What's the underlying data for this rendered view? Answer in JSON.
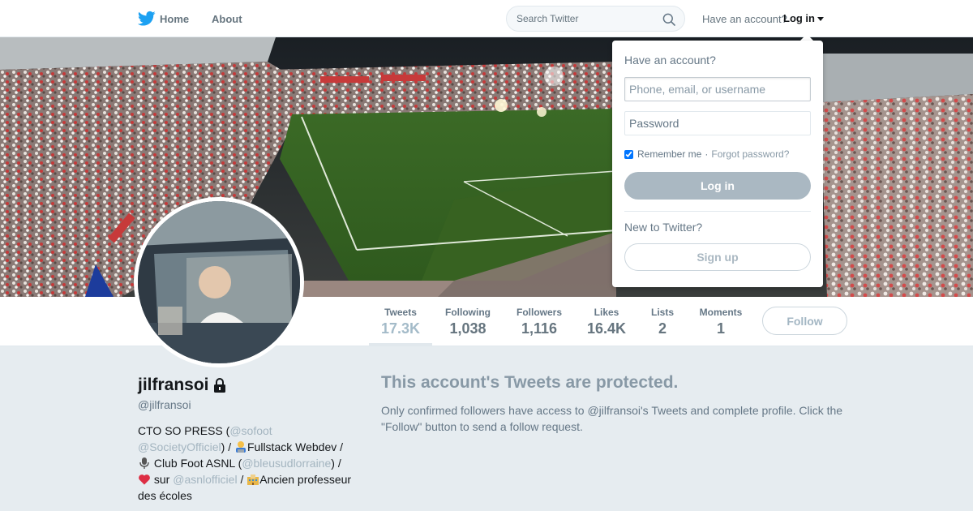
{
  "nav": {
    "logo_icon": "twitter-bird-icon",
    "home_label": "Home",
    "about_label": "About",
    "search_placeholder": "Search Twitter",
    "have_account": "Have an account?",
    "login_label": "Log in"
  },
  "profile": {
    "name": "jilfransoi",
    "handle": "@jilfransoi",
    "bio": {
      "t1": "CTO SO PRESS (",
      "m1": "@sofoot",
      "m2": "@SocietyOfficiel",
      "t2": ") / ",
      "t3": "Fullstack Webdev /",
      "t4": " Club Foot ASNL (",
      "m3": "@bleusudlorraine",
      "t5": ") /",
      "t6": " sur ",
      "m4": "@asnlofficiel",
      "t7": " / ",
      "t8": "Ancien professeur des écoles"
    }
  },
  "stats": [
    {
      "label": "Tweets",
      "value": "17.3K"
    },
    {
      "label": "Following",
      "value": "1,038"
    },
    {
      "label": "Followers",
      "value": "1,116"
    },
    {
      "label": "Likes",
      "value": "16.4K"
    },
    {
      "label": "Lists",
      "value": "2"
    },
    {
      "label": "Moments",
      "value": "1"
    }
  ],
  "follow_label": "Follow",
  "protected": {
    "title": "This account's Tweets are protected.",
    "text": "Only confirmed followers have access to @jilfransoi's Tweets and complete profile. Click the \"Follow\" button to send a follow request."
  },
  "login_dropdown": {
    "title": "Have an account?",
    "username_placeholder": "Phone, email, or username",
    "password_placeholder": "Password",
    "remember_label": "Remember me",
    "separator": "·",
    "forgot_label": "Forgot password?",
    "login_button": "Log in",
    "new_label": "New to Twitter?",
    "signup_button": "Sign up"
  },
  "colors": {
    "brand": "#1da1f2",
    "background": "#e6ecf0"
  }
}
